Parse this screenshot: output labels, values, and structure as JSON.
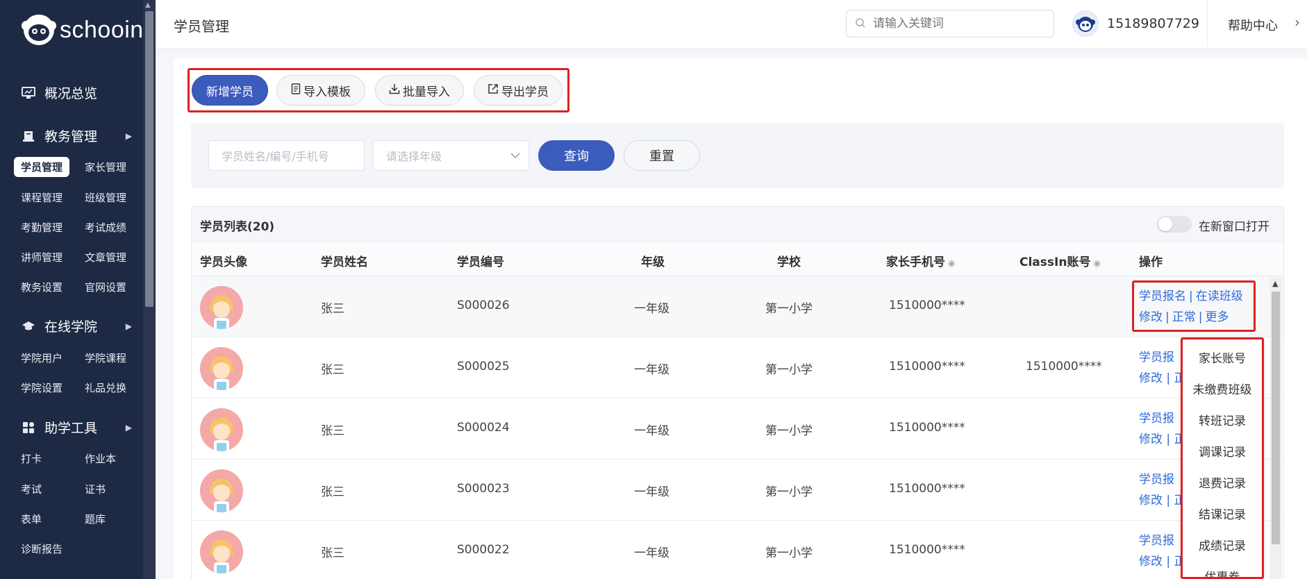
{
  "brand": {
    "name": "schooin"
  },
  "sidebar": {
    "overview": "概况总览",
    "sections": [
      {
        "label": "教务管理",
        "items": [
          "学员管理",
          "家长管理",
          "课程管理",
          "班级管理",
          "考勤管理",
          "考试成绩",
          "讲师管理",
          "文章管理",
          "教务设置",
          "官网设置"
        ]
      },
      {
        "label": "在线学院",
        "items": [
          "学院用户",
          "学院课程",
          "学院设置",
          "礼品兑换"
        ]
      },
      {
        "label": "助学工具",
        "items": [
          "打卡",
          "作业本",
          "考试",
          "证书",
          "表单",
          "题库",
          "诊断报告"
        ]
      }
    ],
    "active_item": "学员管理"
  },
  "header": {
    "title": "学员管理",
    "search_placeholder": "请输入关键词",
    "phone": "15189807729",
    "help": "帮助中心"
  },
  "toolbar": {
    "add": "新增学员",
    "template": "导入模板",
    "batch_import": "批量导入",
    "export": "导出学员"
  },
  "filters": {
    "name_placeholder": "学员姓名/编号/手机号",
    "grade_placeholder": "请选择年级",
    "query": "查询",
    "reset": "重置"
  },
  "table": {
    "title": "学员列表(20)",
    "new_window": "在新窗口打开",
    "columns": [
      "学员头像",
      "学员姓名",
      "学员编号",
      "年级",
      "学校",
      "家长手机号",
      "ClassIn账号",
      "操作"
    ],
    "rows": [
      {
        "name": "张三",
        "id": "S000026",
        "grade": "一年级",
        "school": "第一小学",
        "phone": "1510000****",
        "classin": ""
      },
      {
        "name": "张三",
        "id": "S000025",
        "grade": "一年级",
        "school": "第一小学",
        "phone": "1510000****",
        "classin": "1510000****"
      },
      {
        "name": "张三",
        "id": "S000024",
        "grade": "一年级",
        "school": "第一小学",
        "phone": "1510000****",
        "classin": ""
      },
      {
        "name": "张三",
        "id": "S000023",
        "grade": "一年级",
        "school": "第一小学",
        "phone": "1510000****",
        "classin": ""
      },
      {
        "name": "张三",
        "id": "S000022",
        "grade": "一年级",
        "school": "第一小学",
        "phone": "1510000****",
        "classin": ""
      }
    ],
    "ops": {
      "enroll": "学员报名",
      "current_class": "在读班级",
      "edit": "修改",
      "status": "正常",
      "more": "更多",
      "sep": "|",
      "truncated_line1": "学员报",
      "truncated_line2": "修改 | 正"
    }
  },
  "more_menu": [
    "家长账号",
    "未缴费班级",
    "转班记录",
    "调课记录",
    "退费记录",
    "结课记录",
    "成绩记录",
    "优惠券"
  ],
  "colors": {
    "primary": "#3b5bbd",
    "link": "#2f6bd8",
    "highlight": "#e02020",
    "sidebar": "#1e2a44"
  }
}
